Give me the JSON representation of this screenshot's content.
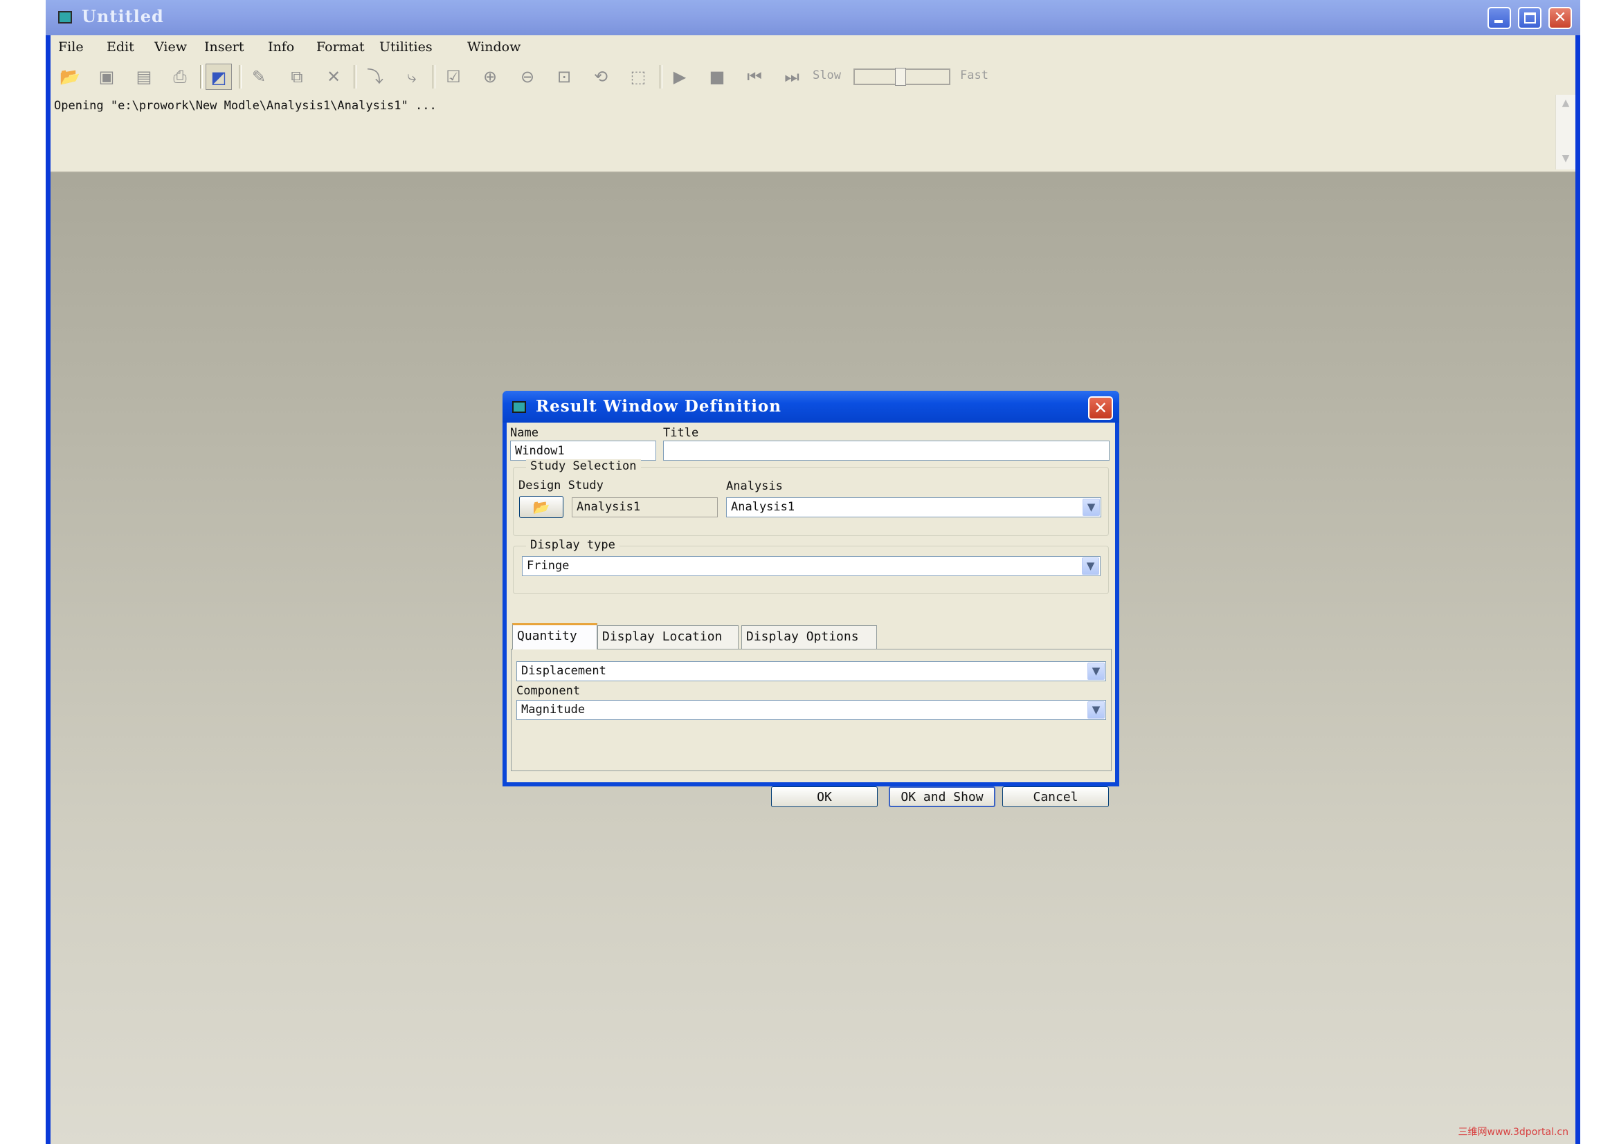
{
  "window": {
    "title": "Untitled",
    "controls": {
      "minimize": "minimize",
      "maximize": "maximize",
      "close": "✕"
    }
  },
  "menu": [
    "File",
    "Edit",
    "View",
    "Insert",
    "Info",
    "Format",
    "Utilities",
    "Window"
  ],
  "toolbar": {
    "icons": [
      "open-folder-icon",
      "save-icon",
      "save-as-icon",
      "print-icon",
      "result-window-icon",
      "edit-definition-icon",
      "copy-icon",
      "delete-icon",
      "insert-after-icon",
      "insert-before-icon",
      "show-icon",
      "zoom-in-icon",
      "zoom-out-icon",
      "zoom-fit-icon",
      "rotate-icon",
      "view-icon",
      "play-icon",
      "stop-icon",
      "rewind-icon",
      "step-end-icon"
    ],
    "speed_slow": "Slow",
    "speed_fast": "Fast"
  },
  "message": "Opening \"e:\\prowork\\New Modle\\Analysis1\\Analysis1\" ...",
  "dialog": {
    "title": "Result Window Definition",
    "close": "✕",
    "name_label": "Name",
    "name_value": "Window1",
    "title_label": "Title",
    "title_value": "",
    "study_group": "Study Selection",
    "design_study_label": "Design Study",
    "design_study_value": "Analysis1",
    "analysis_label": "Analysis",
    "analysis_value": "Analysis1",
    "display_type_group": "Display type",
    "display_type_value": "Fringe",
    "tabs": [
      "Quantity",
      "Display Location",
      "Display Options"
    ],
    "quantity_value": "Displacement",
    "component_label": "Component",
    "component_value": "Magnitude",
    "buttons": {
      "ok": "OK",
      "ok_show": "OK and Show",
      "cancel": "Cancel"
    }
  },
  "watermark": "三维网www.3dportal.cn"
}
